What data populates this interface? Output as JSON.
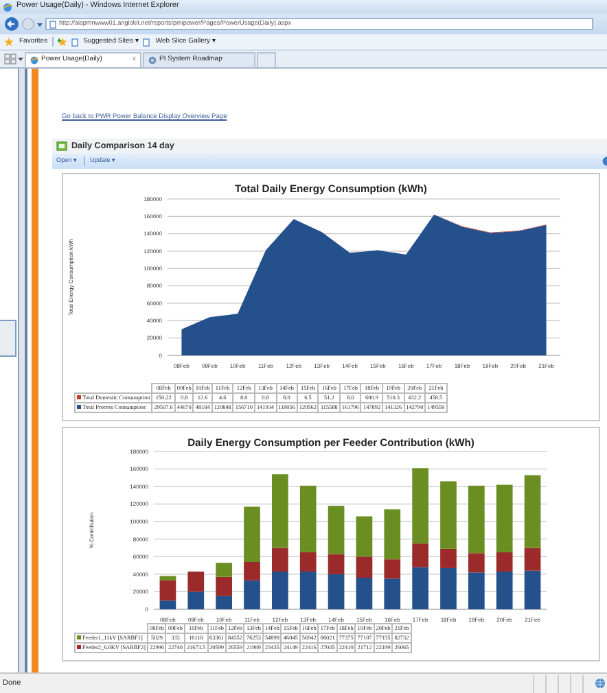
{
  "window": {
    "title": "Power Usage(Daily) - Windows Internet Explorer"
  },
  "address_bar": {
    "url": "http://aispmnwww01.anglokit.net/reports/pmipower/Pages/PowerUsage(Daily).aspx"
  },
  "favorites_bar": {
    "label": "Favorites",
    "items": [
      "Suggested Sites ▾",
      "Web Slice Gallery ▾"
    ]
  },
  "tabs": [
    {
      "label": "Power Usage(Daily)",
      "selected": true,
      "close": "x"
    },
    {
      "label": "PI System Roadmap",
      "selected": false
    }
  ],
  "page": {
    "back_link": "Go back to PWR Power Balance Display Overview Page",
    "web_part": {
      "title": "Daily Comparison 14 day",
      "toolbar": [
        "Open ▾",
        "Update ▾"
      ]
    },
    "charts": [
      {
        "chart_data": {
          "type": "area",
          "title": "Total Daily Energy Consumption (kWh)",
          "ylabel": "Total Energy Consumption kWh",
          "stacked": true,
          "grid": true,
          "categories": [
            "08Feb",
            "09Feb",
            "10Feb",
            "11Feb",
            "12Feb",
            "13Feb",
            "14Feb",
            "15Feb",
            "16Feb",
            "17Feb",
            "18Feb",
            "19Feb",
            "20Feb",
            "21Feb"
          ],
          "ylim": [
            0,
            180000
          ],
          "yticks": [
            0,
            20000,
            40000,
            60000,
            80000,
            100000,
            120000,
            140000,
            160000,
            180000
          ],
          "series": [
            {
              "name": "Total Domestic Consumption",
              "color": "#c0392b",
              "values": [
                200,
                0,
                0,
                0,
                0,
                0,
                0,
                0,
                100,
                0,
                600,
                500,
                400,
                500
              ]
            },
            {
              "name": "Total Process Consumption",
              "color": "#24508c",
              "values": [
                30000,
                44000,
                48000,
                121000,
                157000,
                142000,
                118000,
                121000,
                116000,
                162000,
                148000,
                141000,
                143000,
                150000
              ]
            }
          ]
        },
        "table": {
          "columns": [
            "08Feb",
            "09Feb",
            "10Feb",
            "11Feb",
            "12Feb",
            "13Feb",
            "14Feb",
            "15Feb",
            "16Feb",
            "17Feb",
            "18Feb",
            "19Feb",
            "20Feb",
            "21Feb"
          ],
          "rows": [
            {
              "values": [
                "150.22",
                "0.8",
                "12.6",
                "4.6",
                "8.0",
                "0.8",
                "8.0",
                "6.5",
                "51.2",
                "8.0",
                "600.9",
                "510.3",
                "432.2",
                "458.5"
              ]
            },
            {
              "values": [
                "29507.6",
                "44070",
                "48184",
                "120848",
                "156710",
                "141934",
                "118056",
                "120562",
                "115588",
                "161796",
                "147892",
                "141326",
                "142790",
                "149550"
              ]
            }
          ]
        }
      },
      {
        "chart_data": {
          "type": "bar",
          "title": "Daily Energy Consumption per Feeder Contribution (kWh)",
          "ylabel": "% Contribution",
          "stacked": true,
          "grid": true,
          "categories": [
            "08Feb",
            "09Feb",
            "10Feb",
            "11Feb",
            "12Feb",
            "13Feb",
            "14Feb",
            "15Feb",
            "16Feb",
            "17Feb",
            "18Feb",
            "19Feb",
            "20Feb",
            "21Feb"
          ],
          "ylim": [
            0,
            180000
          ],
          "yticks": [
            0,
            20000,
            40000,
            60000,
            80000,
            100000,
            120000,
            140000,
            160000,
            180000
          ],
          "series": [
            {
              "name": "Feeder1_11kV [SARBF1]",
              "color": "#6b8e23",
              "values": [
                5000,
                0,
                16000,
                63000,
                84000,
                76000,
                55000,
                46000,
                57000,
                86000,
                77000,
                77000,
                77000,
                83000
              ]
            },
            {
              "name": "Feeder2_6.6KV [SARBF2]",
              "color": "#9b2a2a",
              "values": [
                23000,
                23000,
                22000,
                21000,
                27000,
                22000,
                23000,
                24000,
                22000,
                27000,
                22000,
                22000,
                22000,
                26000
              ]
            },
            {
              "color": "#24508c",
              "values": [
                10000,
                20000,
                15000,
                33000,
                43000,
                43000,
                40000,
                36000,
                35000,
                48000,
                47000,
                42000,
                43000,
                44000
              ]
            }
          ]
        },
        "table": {
          "columns": [
            "08Feb",
            "09Feb",
            "10Feb",
            "11Feb",
            "12Feb",
            "13Feb",
            "14Feb",
            "15Feb",
            "16Feb",
            "17Feb",
            "18Feb",
            "19Feb",
            "20Feb",
            "21Feb"
          ],
          "rows": [
            {
              "values": [
                "5029",
                "333",
                "16118",
                "63361",
                "84352",
                "76253",
                "54898",
                "46045",
                "56942",
                "86021",
                "77375",
                "77107",
                "77155",
                "82732"
              ]
            },
            {
              "values": [
                "22996",
                "22740",
                "21673.5",
                "20599",
                "26559",
                "21989",
                "23435",
                "24149",
                "22416",
                "27035",
                "22410",
                "21712",
                "22199",
                "26065"
              ]
            }
          ]
        }
      }
    ]
  },
  "status_bar": {
    "text": "Done"
  }
}
